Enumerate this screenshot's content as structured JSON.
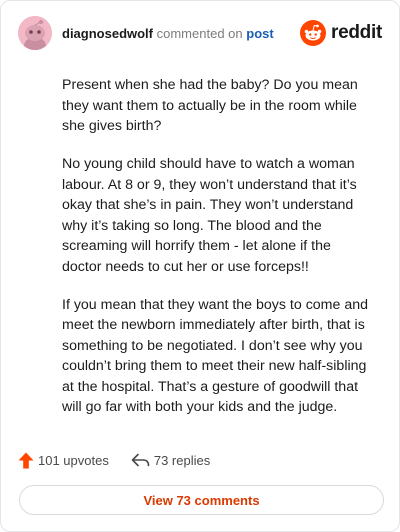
{
  "comment": {
    "author": "diagnosedwolf",
    "action": "commented on",
    "target": "post",
    "paragraphs": [
      "Present when she had the baby? Do you mean they want them to actually be in the room while she gives birth?",
      "No young child should have to watch a woman labour. At 8 or 9, they won’t understand that it’s okay that she’s in pain. They won’t understand why it’s taking so long. The blood and the screaming will horrify them - let alone if the doctor needs to cut her or use forceps!!",
      "If you mean that they want the boys to come and meet the newborn immediately after birth, that is something to be negotiated. I don’t see why you couldn’t bring them to meet their new half-sibling at the hospital. That’s a gesture of goodwill that will go far with both your kids and the judge."
    ]
  },
  "brand": {
    "name": "reddit",
    "color": "#ff4500"
  },
  "stats": {
    "upvotes": "101 upvotes",
    "replies": "73 replies",
    "upvote_icon": "upvote-arrow-icon",
    "reply_icon": "reply-arrow-icon"
  },
  "actions": {
    "view_comments": "View 73 comments"
  },
  "colors": {
    "accent": "#d93a00",
    "link": "#1b5fb3",
    "avatar_bg": "#f2b8c6"
  }
}
